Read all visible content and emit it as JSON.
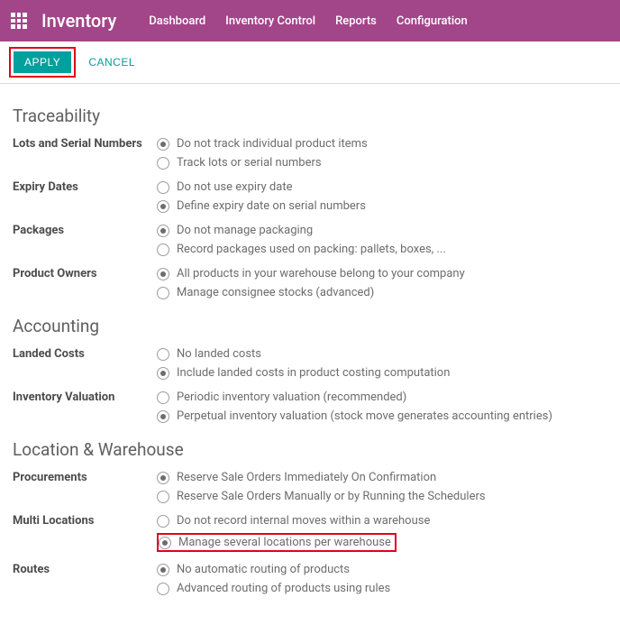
{
  "header": {
    "app_title": "Inventory",
    "nav": [
      "Dashboard",
      "Inventory Control",
      "Reports",
      "Configuration"
    ]
  },
  "actions": {
    "apply": "APPLY",
    "cancel": "CANCEL"
  },
  "groups": [
    {
      "title": "Traceability",
      "rows": [
        {
          "label": "Lots and Serial Numbers",
          "options": [
            {
              "text": "Do not track individual product items",
              "selected": true
            },
            {
              "text": "Track lots or serial numbers",
              "selected": false
            }
          ]
        },
        {
          "label": "Expiry Dates",
          "options": [
            {
              "text": "Do not use expiry date",
              "selected": false
            },
            {
              "text": "Define expiry date on serial numbers",
              "selected": true
            }
          ]
        },
        {
          "label": "Packages",
          "options": [
            {
              "text": "Do not manage packaging",
              "selected": true
            },
            {
              "text": "Record packages used on packing: pallets, boxes, ...",
              "selected": false
            }
          ]
        },
        {
          "label": "Product Owners",
          "options": [
            {
              "text": "All products in your warehouse belong to your company",
              "selected": true
            },
            {
              "text": "Manage consignee stocks (advanced)",
              "selected": false
            }
          ]
        }
      ]
    },
    {
      "title": "Accounting",
      "rows": [
        {
          "label": "Landed Costs",
          "options": [
            {
              "text": "No landed costs",
              "selected": false
            },
            {
              "text": "Include landed costs in product costing computation",
              "selected": true
            }
          ]
        },
        {
          "label": "Inventory Valuation",
          "options": [
            {
              "text": "Periodic inventory valuation (recommended)",
              "selected": false
            },
            {
              "text": "Perpetual inventory valuation (stock move generates accounting entries)",
              "selected": true
            }
          ]
        }
      ]
    },
    {
      "title": "Location & Warehouse",
      "rows": [
        {
          "label": "Procurements",
          "options": [
            {
              "text": "Reserve Sale Orders Immediately On Confirmation",
              "selected": true
            },
            {
              "text": "Reserve Sale Orders Manually or by Running the Schedulers",
              "selected": false
            }
          ]
        },
        {
          "label": "Multi Locations",
          "options": [
            {
              "text": "Do not record internal moves within a warehouse",
              "selected": false
            },
            {
              "text": "Manage several locations per warehouse",
              "selected": true,
              "highlight": true
            }
          ]
        },
        {
          "label": "Routes",
          "options": [
            {
              "text": "No automatic routing of products",
              "selected": true
            },
            {
              "text": "Advanced routing of products using rules",
              "selected": false
            }
          ]
        }
      ]
    }
  ]
}
